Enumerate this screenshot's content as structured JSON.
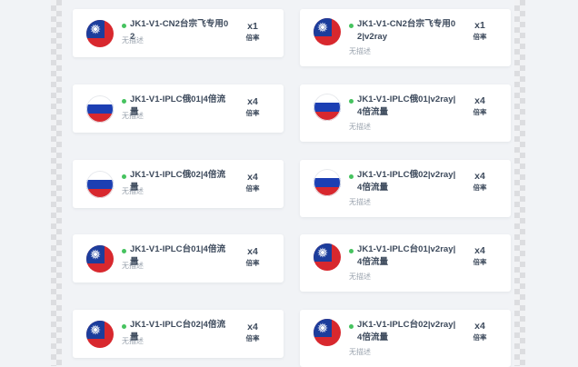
{
  "nodes_left": [
    {
      "flag": "tw-flag-icon",
      "name": "JK1-V1-CN2台宗飞专用02",
      "desc": "无描述",
      "rate": "x1",
      "rate_label": "倍率",
      "status_color": "#46c35f"
    },
    {
      "flag": "ru-flag-icon",
      "name": "JK1-V1-IPLC俄01|4倍流量",
      "desc": "无描述",
      "rate": "x4",
      "rate_label": "倍率",
      "status_color": "#46c35f"
    },
    {
      "flag": "ru-flag-icon",
      "name": "JK1-V1-IPLC俄02|4倍流量",
      "desc": "无描述",
      "rate": "x4",
      "rate_label": "倍率",
      "status_color": "#46c35f"
    },
    {
      "flag": "tw-flag-icon",
      "name": "JK1-V1-IPLC台01|4倍流量",
      "desc": "无描述",
      "rate": "x4",
      "rate_label": "倍率",
      "status_color": "#46c35f"
    },
    {
      "flag": "tw-flag-icon",
      "name": "JK1-V1-IPLC台02|4倍流量",
      "desc": "无描述",
      "rate": "x4",
      "rate_label": "倍率",
      "status_color": "#46c35f"
    }
  ],
  "nodes_right": [
    {
      "flag": "tw-flag-icon",
      "name": "JK1-V1-CN2台宗飞专用02|v2ray",
      "desc": "无描述",
      "rate": "x1",
      "rate_label": "倍率",
      "status_color": "#46c35f"
    },
    {
      "flag": "ru-flag-icon",
      "name": "JK1-V1-IPLC俄01|v2ray|4倍流量",
      "desc": "无描述",
      "rate": "x4",
      "rate_label": "倍率",
      "status_color": "#46c35f"
    },
    {
      "flag": "ru-flag-icon",
      "name": "JK1-V1-IPLC俄02|v2ray|4倍流量",
      "desc": "无描述",
      "rate": "x4",
      "rate_label": "倍率",
      "status_color": "#46c35f"
    },
    {
      "flag": "tw-flag-icon",
      "name": "JK1-V1-IPLC台01|v2ray|4倍流量",
      "desc": "无描述",
      "rate": "x4",
      "rate_label": "倍率",
      "status_color": "#46c35f"
    },
    {
      "flag": "tw-flag-icon",
      "name": "JK1-V1-IPLC台02|v2ray|4倍流量",
      "desc": "无描述",
      "rate": "x4",
      "rate_label": "倍率",
      "status_color": "#46c35f"
    }
  ]
}
